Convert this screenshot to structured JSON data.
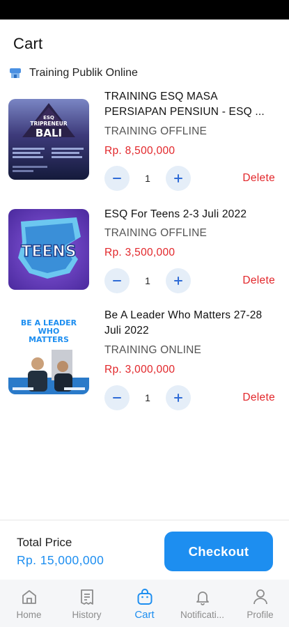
{
  "header": {
    "title": "Cart"
  },
  "store": {
    "name": "Training Publik Online",
    "icon": "store-icon"
  },
  "items": [
    {
      "title": "TRAINING ESQ MASA PERSIAPAN PENSIUN - ESQ ...",
      "type": "TRAINING OFFLINE",
      "price": "Rp. 8,500,000",
      "qty": "1",
      "delete_label": "Delete",
      "thumb": {
        "badge": "ESQ",
        "line1": "TRIPRENEUR",
        "line2": "BALI"
      }
    },
    {
      "title": "ESQ For Teens 2-3 Juli 2022",
      "type": "TRAINING OFFLINE",
      "price": "Rp. 3,500,000",
      "qty": "1",
      "delete_label": "Delete",
      "thumb": {
        "line1": "TEENS"
      }
    },
    {
      "title": "Be A Leader Who Matters 27-28 Juli 2022",
      "type": "TRAINING ONLINE",
      "price": "Rp. 3,000,000",
      "qty": "1",
      "delete_label": "Delete",
      "thumb": {
        "line1": "BE A LEADER",
        "line2": "WHO",
        "line3": "MATTERS"
      }
    }
  ],
  "footer": {
    "total_label": "Total Price",
    "total_value": "Rp. 15,000,000",
    "checkout_label": "Checkout"
  },
  "nav": [
    {
      "label": "Home",
      "icon": "home-icon"
    },
    {
      "label": "History",
      "icon": "receipt-icon"
    },
    {
      "label": "Cart",
      "icon": "shopping-bag-icon",
      "active": true
    },
    {
      "label": "Notificati...",
      "icon": "bell-icon"
    },
    {
      "label": "Profile",
      "icon": "person-icon"
    }
  ],
  "colors": {
    "accent": "#1d8ef0",
    "price": "#e2262a",
    "qty_button_bg": "#e5eef8"
  }
}
